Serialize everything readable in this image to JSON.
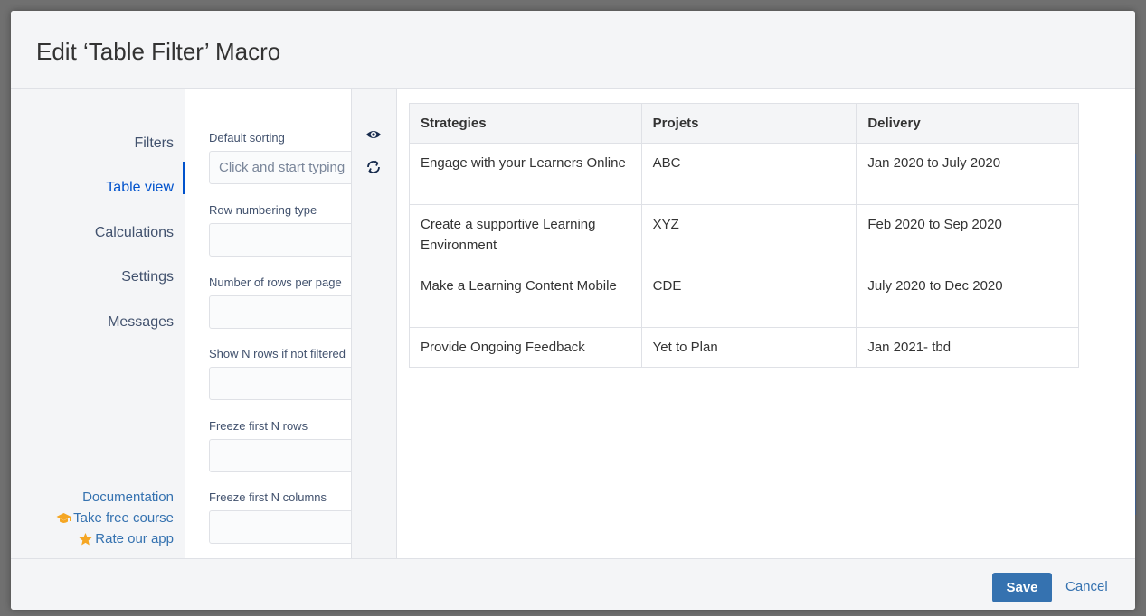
{
  "dialog": {
    "title": "Edit ‘Table Filter’ Macro"
  },
  "nav": {
    "items": [
      {
        "label": "Filters",
        "active": false
      },
      {
        "label": "Table view",
        "active": true
      },
      {
        "label": "Calculations",
        "active": false
      },
      {
        "label": "Settings",
        "active": false
      },
      {
        "label": "Messages",
        "active": false
      }
    ],
    "links": [
      {
        "label": "Documentation",
        "icon": ""
      },
      {
        "label": "Take free course",
        "icon": "graduation-cap-icon"
      },
      {
        "label": "Rate our app",
        "icon": "star-icon"
      }
    ]
  },
  "form": {
    "fields": [
      {
        "label": "Default sorting",
        "value": "",
        "placeholder": "Click and start typing"
      },
      {
        "label": "Row numbering type",
        "value": "",
        "placeholder": ""
      },
      {
        "label": "Number of rows per page",
        "value": "",
        "placeholder": ""
      },
      {
        "label": "Show N rows if not filtered",
        "value": "",
        "placeholder": ""
      },
      {
        "label": "Freeze first N rows",
        "value": "",
        "placeholder": ""
      },
      {
        "label": "Freeze first N columns",
        "value": "",
        "placeholder": ""
      }
    ]
  },
  "toolbar": {
    "preview_icon": "eye-icon",
    "refresh_icon": "refresh-icon"
  },
  "preview": {
    "columns": [
      "Strategies",
      "Projets",
      "Delivery"
    ],
    "rows": [
      [
        "Engage with your Learners Online",
        "ABC",
        "Jan 2020 to July 2020"
      ],
      [
        "Create a supportive Learning Environment",
        "XYZ",
        "Feb 2020 to Sep 2020"
      ],
      [
        "Make a Learning Content Mobile",
        "CDE",
        "July 2020 to Dec 2020"
      ],
      [
        "Provide Ongoing Feedback",
        "Yet to Plan",
        "Jan 2021- tbd"
      ]
    ]
  },
  "footer": {
    "save_label": "Save",
    "cancel_label": "Cancel"
  },
  "colors": {
    "accent": "#0052cc",
    "button": "#3572b0",
    "link": "#3572b0",
    "icon_orange": "#f5a623"
  }
}
